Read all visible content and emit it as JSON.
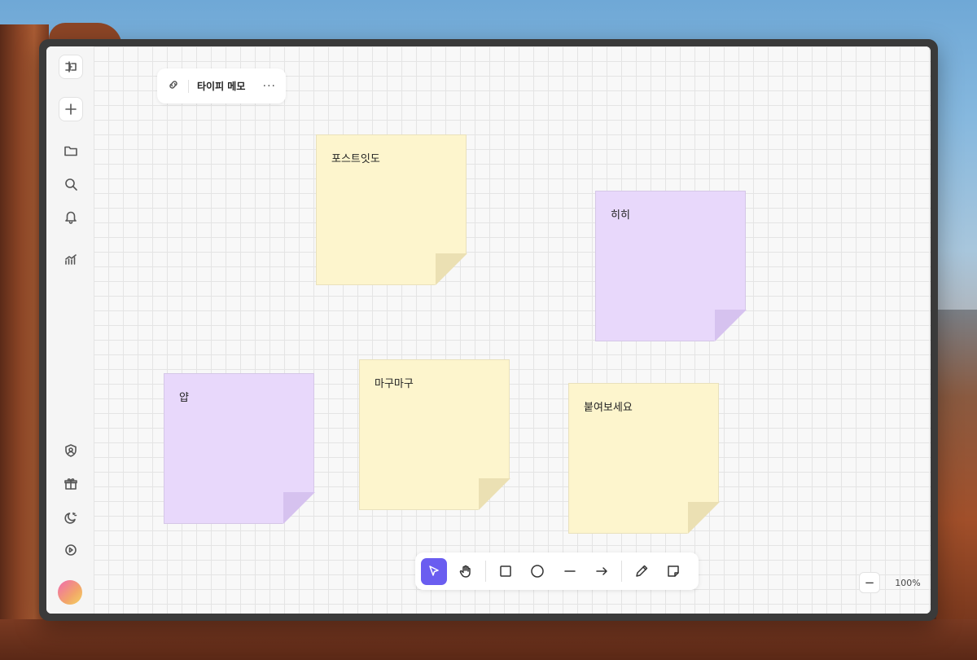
{
  "doc": {
    "title": "타이피 메모",
    "more": "···"
  },
  "sidebar": {
    "logo": "logo-icon",
    "items": [
      {
        "name": "add",
        "icon": "plus-icon"
      },
      {
        "name": "folder",
        "icon": "folder-icon"
      },
      {
        "name": "search",
        "icon": "search-icon"
      },
      {
        "name": "notifications",
        "icon": "bell-icon"
      },
      {
        "name": "analytics",
        "icon": "chart-icon"
      },
      {
        "name": "security",
        "icon": "shield-user-icon"
      },
      {
        "name": "gift",
        "icon": "gift-icon"
      },
      {
        "name": "theme",
        "icon": "moon-icon"
      },
      {
        "name": "settings",
        "icon": "gear-icon"
      }
    ]
  },
  "notes": [
    {
      "text": "포스트잇도",
      "color": "yellow"
    },
    {
      "text": "히히",
      "color": "purple"
    },
    {
      "text": "얍",
      "color": "purple"
    },
    {
      "text": "마구마구",
      "color": "yellow"
    },
    {
      "text": "붙여보세요",
      "color": "yellow"
    }
  ],
  "toolbar": {
    "tools": [
      "select",
      "hand",
      "rectangle",
      "ellipse",
      "line",
      "arrow",
      "pencil",
      "sticky-note"
    ],
    "active": "select"
  },
  "zoom": {
    "minus": "−",
    "value": "100%",
    "plus": "+"
  },
  "colors": {
    "accent": "#6a5df0",
    "note_yellow": "#fdf5cd",
    "note_purple": "#e8d8fb"
  }
}
